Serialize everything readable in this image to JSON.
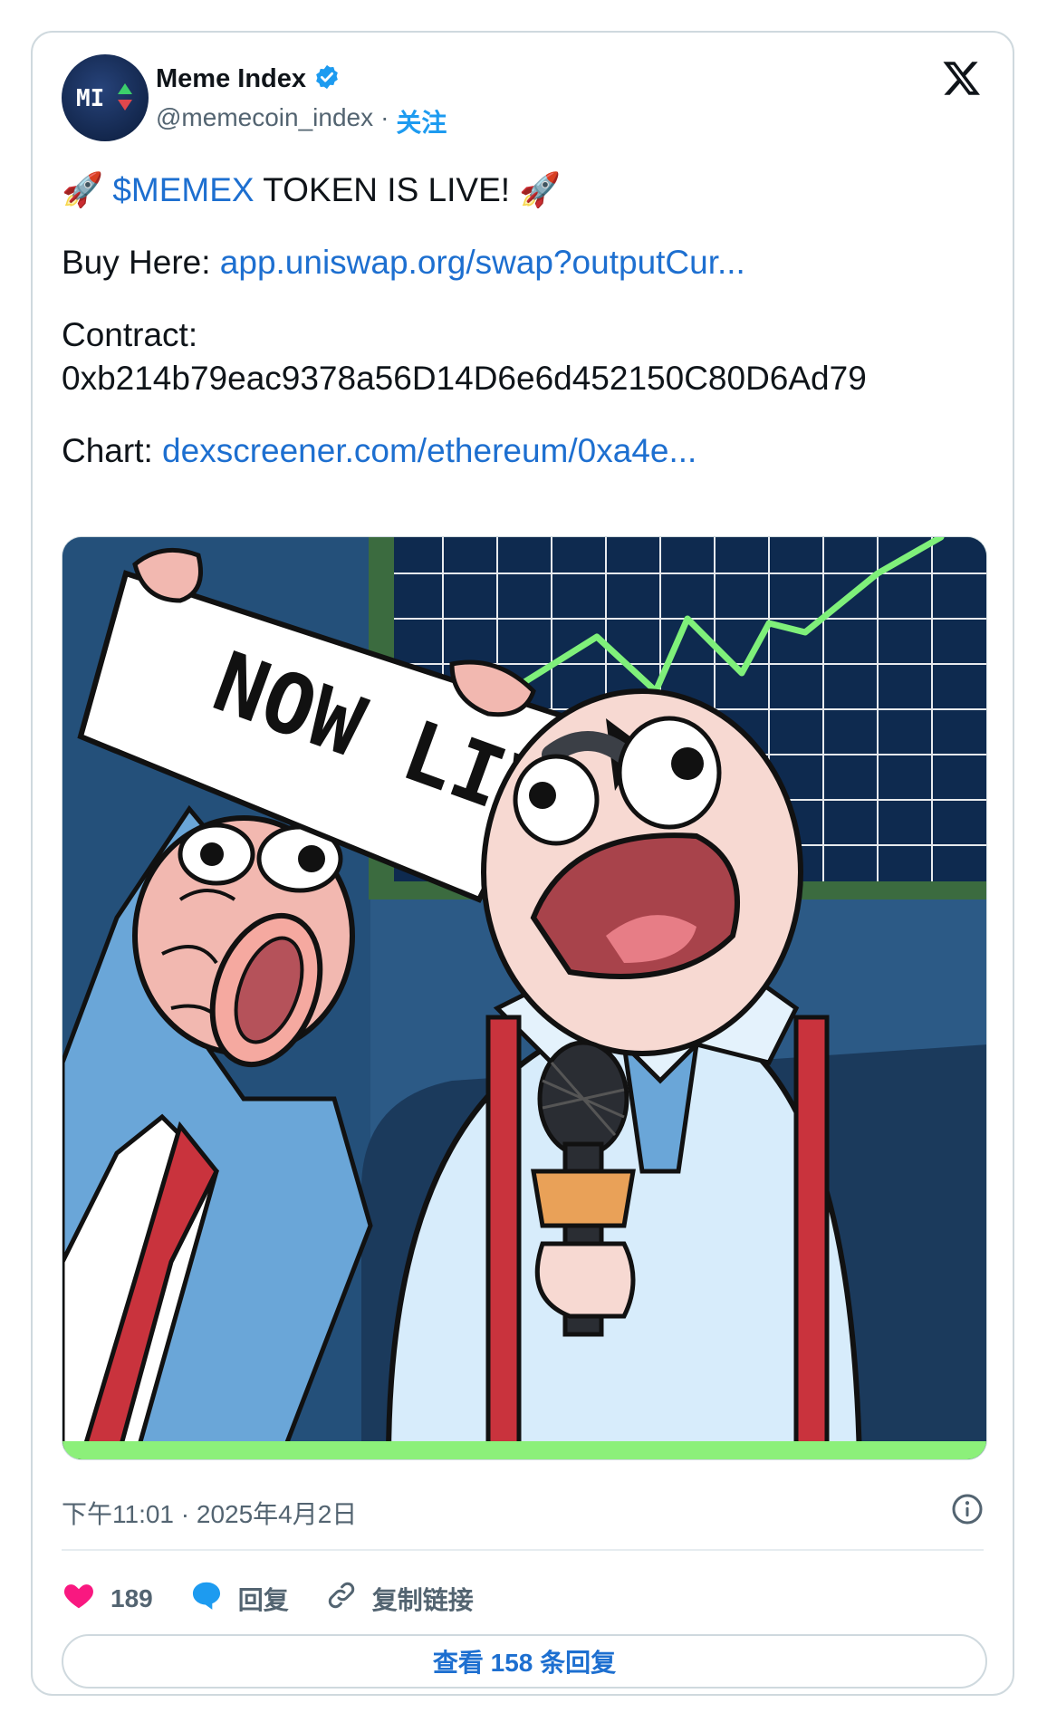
{
  "user": {
    "display_name": "Meme Index",
    "handle": "@memecoin_index",
    "separator": "·",
    "follow_label": "关注",
    "avatar_text": "MI",
    "verified": true
  },
  "tweet": {
    "line1_rocket_left": "🚀",
    "line1_cashtag": "$MEMEX",
    "line1_text": " TOKEN IS LIVE! ",
    "line1_rocket_right": "🚀",
    "buy_label": "Buy Here: ",
    "buy_link": "app.uniswap.org/swap?outputCur...",
    "contract_label": "Contract:",
    "contract_address": "0xb214b79eac9378a56D14D6e6d452150C80D6Ad79",
    "chart_label": "Chart: ",
    "chart_link": "dexscreener.com/ethereum/0xa4e..."
  },
  "media": {
    "sign_text": "NOW LIVE",
    "colors": {
      "background": "#2c5a86",
      "chart_bg": "#0e2a4f",
      "chart_line": "#7ff07a",
      "ground_strip": "#8cf07a",
      "tie_red": "#c9333d",
      "skin": "#f7d9d2"
    }
  },
  "meta": {
    "timestamp": "下午11:01 · 2025年4月2日"
  },
  "actions": {
    "like_count": "189",
    "reply_label": "回复",
    "copy_link_label": "复制链接",
    "view_replies_label": "查看 158 条回复"
  },
  "colors": {
    "link": "#1d6fd0",
    "verified": "#1d9bf0",
    "like": "#f91880",
    "muted": "#536471"
  }
}
